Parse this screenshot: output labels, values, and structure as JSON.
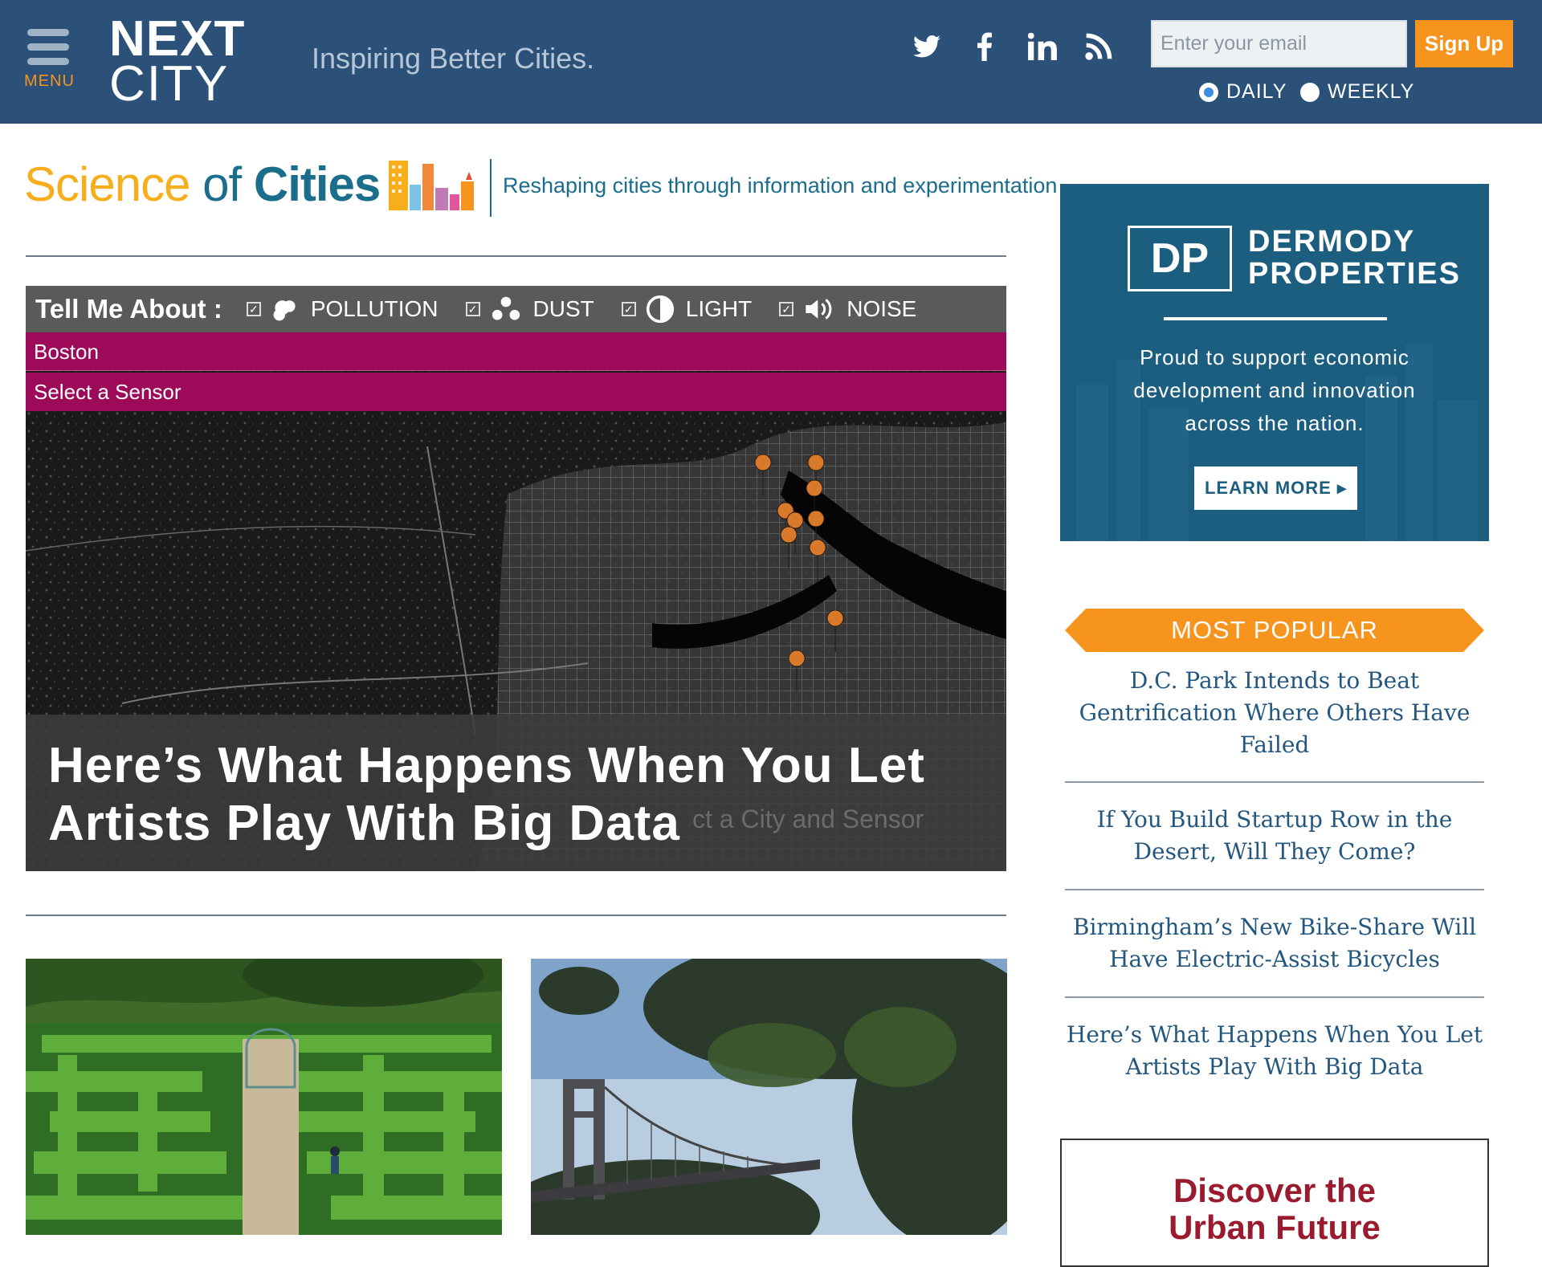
{
  "header": {
    "menu_label": "MENU",
    "logo_line1": "NEXT",
    "logo_line2": "CITY",
    "tagline": "Inspiring Better Cities.",
    "social": [
      "twitter-icon",
      "facebook-icon",
      "linkedin-icon",
      "rss-icon"
    ],
    "email_placeholder": "Enter your email",
    "signup_label": "Sign Up",
    "frequency": [
      {
        "label": "DAILY",
        "selected": true
      },
      {
        "label": "WEEKLY",
        "selected": false
      }
    ]
  },
  "section": {
    "title_part1": "Science",
    "title_part2": "of",
    "title_part3": "Cities",
    "tagline": "Reshaping cities through information and experimentation"
  },
  "hero": {
    "toolbar_label": "Tell Me About :",
    "filters": [
      {
        "label": "POLLUTION",
        "icon": "cloud-icon"
      },
      {
        "label": "DUST",
        "icon": "dust-icon"
      },
      {
        "label": "LIGHT",
        "icon": "light-icon"
      },
      {
        "label": "NOISE",
        "icon": "speaker-icon"
      }
    ],
    "city": "Boston",
    "sensor_select": "Select a Sensor",
    "ghost_text": "ct a City and Sensor",
    "title": "Here’s What Happens When You Let Artists Play With Big Data"
  },
  "sidebar": {
    "ad": {
      "logo": "DP",
      "brand_line1": "DERMODY",
      "brand_line2": "PROPERTIES",
      "copy_line1": "Proud to support economic",
      "copy_line2": "development and innovation",
      "copy_line3": "across the nation.",
      "cta": "LEARN MORE ▸"
    },
    "most_popular_label": "MOST POPULAR",
    "popular": [
      "D.C. Park Intends to Beat Gentrification Where Others Have Failed",
      "If You Build Startup Row in the Desert, Will They Come?",
      "Birmingham’s New Bike-Share Will Have Electric-Assist Bicycles",
      "Here’s What Happens When You Let Artists Play With Big Data"
    ],
    "ad2_line1": "Discover the",
    "ad2_line2": "Urban Future"
  },
  "colors": {
    "header_bg": "#2b5179",
    "accent_orange": "#f7941e",
    "magenta": "#9c0a59",
    "link_blue": "#24577f"
  }
}
